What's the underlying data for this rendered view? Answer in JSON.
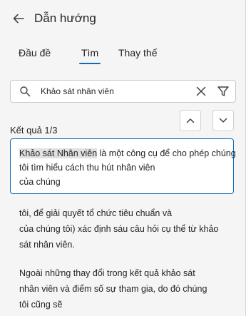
{
  "header": {
    "title": "Dẫn hướng"
  },
  "tabs": [
    {
      "label": "Đầu đề",
      "selected": false
    },
    {
      "label": "Tìm",
      "selected": true
    },
    {
      "label": "Thay thế",
      "selected": false
    }
  ],
  "search": {
    "value": "Khảo sát nhân viên",
    "placeholder": ""
  },
  "results": {
    "count_label": "Kết quả 1/3",
    "first": {
      "highlight": "Khảo sát Nhân viên",
      "line1_rest": " là một công cụ để cho phép chúng",
      "line2": "tôi tìm hiểu cách thu hút nhân viên",
      "line3": "của chúng"
    },
    "context1": {
      "line1": "tôi, để giải quyết tổ chức tiêu chuẩn và",
      "line2": "của chúng tôi) xác định sáu câu hỏi cụ thể từ khảo",
      "line3": "sát nhân viên."
    },
    "context2": {
      "line1": "Ngoài những thay đổi trong kết quả khảo sát",
      "line2": "nhân viên và điểm số sự tham gia, do đó chúng",
      "line3": "tôi cũng sẽ"
    }
  },
  "icons": {
    "back": "arrow-left",
    "search": "magnifier",
    "clear": "x",
    "filter": "funnel",
    "previous": "chevron-up",
    "next": "chevron-down"
  },
  "colors": {
    "accent": "#0f6cbd",
    "pane_background": "#f5f5f5",
    "highlight": "#e0e0e0"
  }
}
